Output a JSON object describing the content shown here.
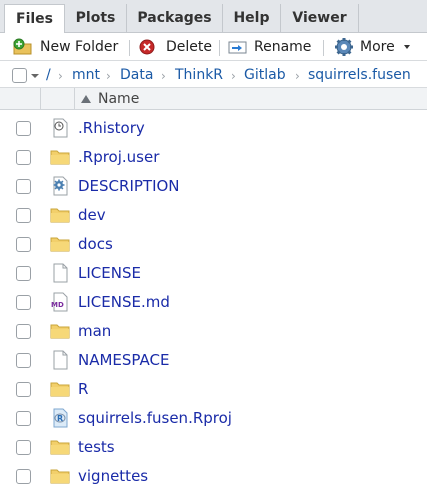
{
  "tabs": [
    {
      "label": "Files"
    },
    {
      "label": "Plots"
    },
    {
      "label": "Packages"
    },
    {
      "label": "Help"
    },
    {
      "label": "Viewer"
    }
  ],
  "toolbar": {
    "new_folder": "New Folder",
    "delete": "Delete",
    "rename": "Rename",
    "more": "More"
  },
  "breadcrumb": [
    {
      "label": "/"
    },
    {
      "label": "mnt"
    },
    {
      "label": "Data"
    },
    {
      "label": "ThinkR"
    },
    {
      "label": "Gitlab"
    },
    {
      "label": "squirrels.fusen"
    }
  ],
  "header": {
    "name": "Name"
  },
  "files": [
    {
      "name": ".Rhistory",
      "icon": "history-file-icon"
    },
    {
      "name": ".Rproj.user",
      "icon": "folder-icon"
    },
    {
      "name": "DESCRIPTION",
      "icon": "gear-file-icon"
    },
    {
      "name": "dev",
      "icon": "folder-icon"
    },
    {
      "name": "docs",
      "icon": "folder-icon"
    },
    {
      "name": "LICENSE",
      "icon": "text-file-icon"
    },
    {
      "name": "LICENSE.md",
      "icon": "markdown-file-icon"
    },
    {
      "name": "man",
      "icon": "folder-icon"
    },
    {
      "name": "NAMESPACE",
      "icon": "text-file-icon"
    },
    {
      "name": "R",
      "icon": "folder-icon"
    },
    {
      "name": "squirrels.fusen.Rproj",
      "icon": "rproj-file-icon"
    },
    {
      "name": "tests",
      "icon": "folder-icon"
    },
    {
      "name": "vignettes",
      "icon": "folder-icon"
    }
  ]
}
